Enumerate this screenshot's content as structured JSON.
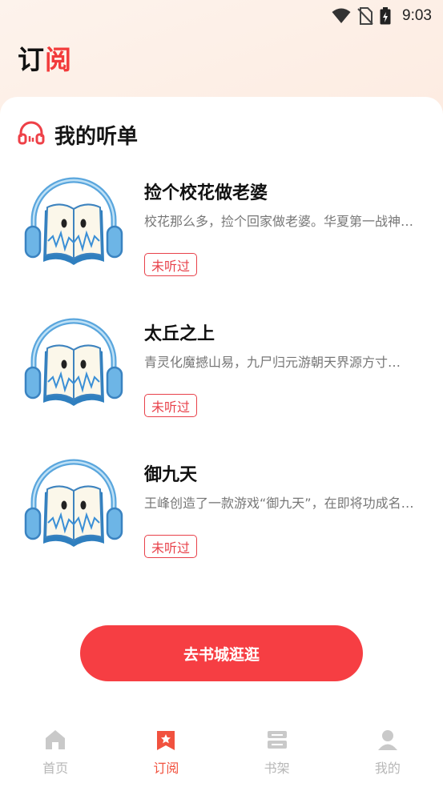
{
  "status_bar": {
    "time": "9:03"
  },
  "header": {
    "title_part1": "订",
    "title_part2": "阅"
  },
  "section": {
    "title": "我的听单"
  },
  "books": [
    {
      "title": "捡个校花做老婆",
      "desc": "校花那么多，捡个回家做老婆。华夏第一战神…",
      "status": "未听过"
    },
    {
      "title": "太丘之上",
      "desc": "青灵化魔撼山易，九尸归元游朝天界源方寸…",
      "status": "未听过"
    },
    {
      "title": "御九天",
      "desc": "王峰创造了一款游戏“御九天”，在即将功成名就…",
      "status": "未听过"
    }
  ],
  "cta": {
    "label": "去书城逛逛"
  },
  "tabbar": {
    "items": [
      {
        "label": "首页",
        "icon": "home-icon"
      },
      {
        "label": "订阅",
        "icon": "subscribe-icon"
      },
      {
        "label": "书架",
        "icon": "bookshelf-icon"
      },
      {
        "label": "我的",
        "icon": "profile-icon"
      }
    ],
    "active_index": 1
  },
  "colors": {
    "accent": "#f63e43",
    "active_tab": "#f1523f",
    "inactive_tab": "#b7b7b7"
  }
}
